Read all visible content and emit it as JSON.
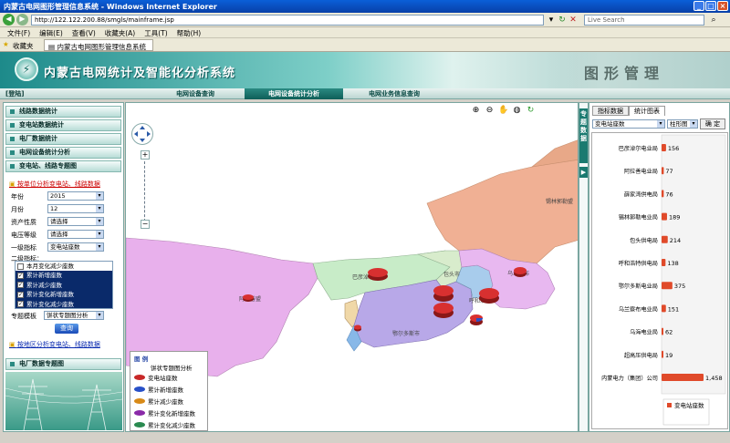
{
  "window": {
    "title": "内蒙古电网图形管理信息系统 - Windows Internet Explorer"
  },
  "browser": {
    "address": "http://122.122.200.88/smgls/mainframe.jsp",
    "search_placeholder": "Live Search",
    "menu": [
      "文件(F)",
      "编辑(E)",
      "查看(V)",
      "收藏夹(A)",
      "工具(T)",
      "帮助(H)"
    ],
    "favorites_label": "收藏夹",
    "tab_title": "内蒙古电网图形管理信息系统"
  },
  "header": {
    "title": "内蒙古电网统计及智能化分析系统",
    "module": "图形管理"
  },
  "nav": {
    "login": "[登陆]",
    "tabs": [
      "电网设备查询",
      "电网设备统计分析",
      "电网业务信息查询"
    ],
    "active": 1
  },
  "left": {
    "sections": [
      "线路数据统计",
      "变电站数据统计",
      "电厂数据统计",
      "电网设备统计分析",
      "变电站、线路专题图"
    ],
    "link1": "按单位分析变电站、线路数据",
    "fields": [
      {
        "label": "年份",
        "value": "2015"
      },
      {
        "label": "月份",
        "value": "12"
      },
      {
        "label": "资产性质",
        "value": "请选择"
      },
      {
        "label": "电压等级",
        "value": "请选择"
      },
      {
        "label": "一级指标",
        "value": "变电站座数"
      }
    ],
    "idx_label": "二级指标：",
    "idx_items": [
      {
        "label": "本月变化减少座数",
        "checked": false
      },
      {
        "label": "累计新增座数",
        "checked": true
      },
      {
        "label": "累计减少座数",
        "checked": true
      },
      {
        "label": "累计变化新增座数",
        "checked": true
      },
      {
        "label": "累计变化减少座数",
        "checked": true
      }
    ],
    "theme_label": "专题模板",
    "theme_value": "饼状专题图分析",
    "query": "查询",
    "link2": "按地区分析变电站、线路数据",
    "bottom_section": "电厂数据专题图"
  },
  "map": {
    "labels": [
      "锡林郭勒盟",
      "巴彦淖尔",
      "包头市",
      "呼和浩特",
      "阿拉善盟",
      "鄂尔多斯市",
      "乌兰察布"
    ],
    "legend": {
      "title": "图 例",
      "subtitle": "饼状专题图分析",
      "items": [
        {
          "label": "变电站座数",
          "color": "#c82828"
        },
        {
          "label": "累计新增座数",
          "color": "#2850c8"
        },
        {
          "label": "累计减少座数",
          "color": "#d88a18"
        },
        {
          "label": "累计变化新增座数",
          "color": "#8a2aa8"
        },
        {
          "label": "累计变化减少座数",
          "color": "#2a8a50"
        }
      ]
    }
  },
  "right": {
    "collapse_tab": "专题数据",
    "tabs": [
      "指标数据",
      "统计图表"
    ],
    "active_tab": 1,
    "indicator": "变电站座数",
    "chart_type": "柱形图",
    "confirm": "确 定"
  },
  "chart_data": {
    "type": "bar",
    "orientation": "horizontal",
    "categories": [
      "巴彦淖尔电业局",
      "阿拉善电业局",
      "薛家湾供电局",
      "锡林郭勒电业局",
      "包头供电局",
      "呼和浩特供电局",
      "鄂尔多斯电业局",
      "乌兰察布电业局",
      "乌海电业局",
      "超高压供电局",
      "内蒙电力（集团）公司"
    ],
    "values": [
      156,
      77,
      76,
      189,
      214,
      138,
      375,
      151,
      62,
      19,
      1458
    ],
    "value_labels": [
      "156",
      "77",
      "76",
      "189",
      "214",
      "138",
      "375",
      "151",
      "62",
      "19",
      "1,458"
    ],
    "series": [
      {
        "name": "变电站座数",
        "values": [
          156,
          77,
          76,
          189,
          214,
          138,
          375,
          151,
          62,
          19,
          1458
        ]
      }
    ],
    "legend": "bottom",
    "color": "#e04a2a"
  }
}
